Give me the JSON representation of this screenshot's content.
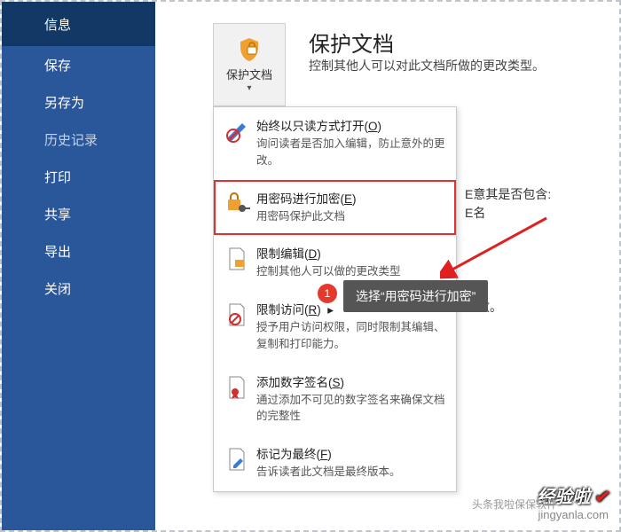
{
  "sidebar": {
    "items": [
      {
        "label": "信息"
      },
      {
        "label": "保存"
      },
      {
        "label": "另存为"
      },
      {
        "label": "历史记录"
      },
      {
        "label": "打印"
      },
      {
        "label": "共享"
      },
      {
        "label": "导出"
      },
      {
        "label": "关闭"
      }
    ]
  },
  "header": {
    "title": "保护文档",
    "subtitle": "控制其他人可以对此文档所做的更改类型。"
  },
  "protect_button": {
    "label": "保护文档"
  },
  "menu": {
    "items": [
      {
        "title_pre": "始终以只读方式打开(",
        "hotkey": "O",
        "title_post": ")",
        "desc": "询问读者是否加入编辑，防止意外的更改。"
      },
      {
        "title_pre": "用密码进行加密(",
        "hotkey": "E",
        "title_post": ")",
        "desc": "用密码保护此文档"
      },
      {
        "title_pre": "限制编辑(",
        "hotkey": "D",
        "title_post": ")",
        "desc": "控制其他人可以做的更改类型"
      },
      {
        "title_pre": "限制访问(",
        "hotkey": "R",
        "title_post": ")",
        "desc": "授予用户访问权限，同时限制其编辑、复制和打印能力。"
      },
      {
        "title_pre": "添加数字签名(",
        "hotkey": "S",
        "title_post": ")",
        "desc": "通过添加不可见的数字签名来确保文档的完整性"
      },
      {
        "title_pre": "标记为最终(",
        "hotkey": "F",
        "title_post": ")",
        "desc": "告诉读者此文档是最终版本。"
      }
    ]
  },
  "side_text": {
    "line1": "E意其是否包含:",
    "line2": "E名",
    "line3": "更改。"
  },
  "annotation": {
    "badge": "1",
    "tooltip": "选择“用密码进行加密”"
  },
  "watermark": {
    "brand": "经验啦",
    "url": "jingyanla.com",
    "sub": "头条我啦保保软件"
  }
}
